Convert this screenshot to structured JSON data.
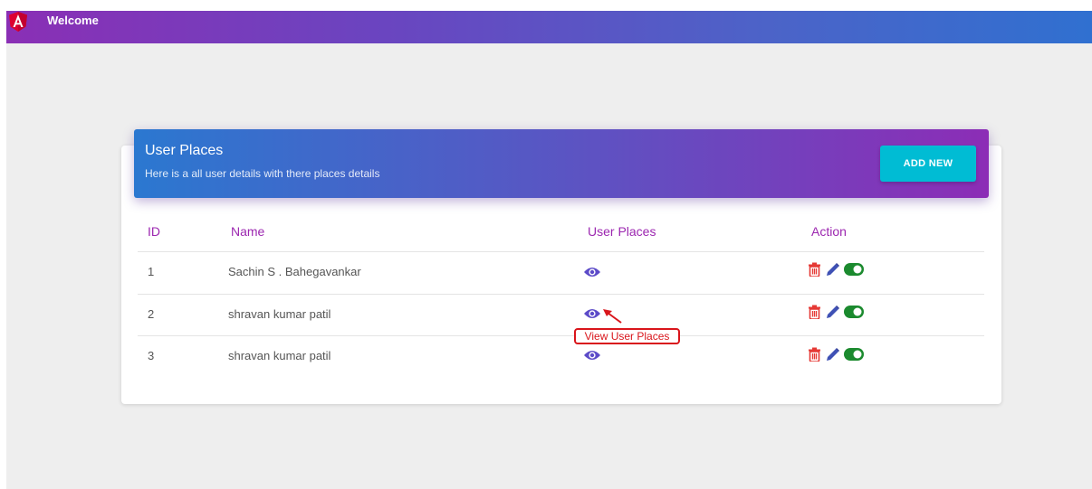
{
  "navbar": {
    "title": "Welcome"
  },
  "card": {
    "title": "User Places",
    "subtitle": "Here is a all user details with there places details",
    "add_button": "ADD NEW"
  },
  "table": {
    "headers": [
      "ID",
      "Name",
      "User Places",
      "Action"
    ],
    "rows": [
      {
        "id": "1",
        "name": "Sachin S . Bahegavankar"
      },
      {
        "id": "2",
        "name": "shravan kumar patil"
      },
      {
        "id": "3",
        "name": "shravan kumar patil"
      }
    ]
  },
  "annotation": {
    "label": "View User Places"
  },
  "colors": {
    "header_text": "#9c27b0",
    "add_button": "#00bcd4",
    "delete_icon": "#e53935",
    "edit_icon": "#3f51b5",
    "toggle": "#1b8a2e",
    "eye_icon": "#5c4bc8",
    "annotation": "#d9151b"
  }
}
